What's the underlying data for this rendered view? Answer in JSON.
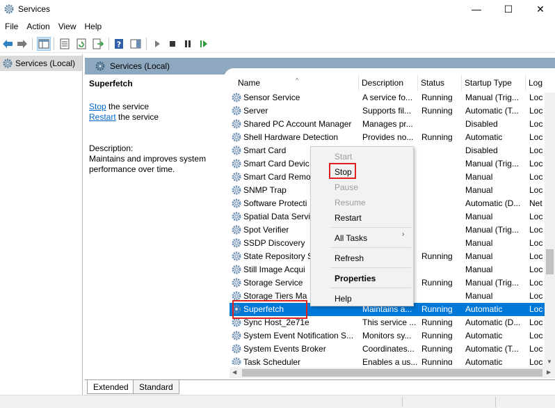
{
  "window": {
    "title": "Services",
    "controls": {
      "minimize": "—",
      "maximize": "☐",
      "close": "✕"
    }
  },
  "menu": [
    "File",
    "Action",
    "View",
    "Help"
  ],
  "toolbar": {
    "icons": [
      "back-arrow-icon",
      "forward-arrow-icon",
      "show-tree-icon",
      "properties-sheet-icon",
      "refresh-icon",
      "export-list-icon",
      "help-icon",
      "show-hide-pane-icon",
      "start-service-icon",
      "stop-service-icon",
      "pause-service-icon",
      "restart-service-icon"
    ]
  },
  "tree": {
    "root_label": "Services (Local)"
  },
  "main": {
    "header_title": "Services (Local)",
    "selected_service": "Superfetch",
    "stop_link": "Stop",
    "stop_suffix": " the service",
    "restart_link": "Restart",
    "restart_suffix": " the service",
    "description_label": "Description:",
    "description_text": "Maintains and improves system performance over time."
  },
  "columns": {
    "name": "Name",
    "description": "Description",
    "status": "Status",
    "startup": "Startup Type",
    "log": "Log"
  },
  "rows": [
    {
      "name": "Sensor Service",
      "description": "A service fo...",
      "status": "Running",
      "startup": "Manual (Trig...",
      "log": "Loc"
    },
    {
      "name": "Server",
      "description": "Supports fil...",
      "status": "Running",
      "startup": "Automatic (T...",
      "log": "Loc"
    },
    {
      "name": "Shared PC Account Manager",
      "description": "Manages pr...",
      "status": "",
      "startup": "Disabled",
      "log": "Loc"
    },
    {
      "name": "Shell Hardware Detection",
      "description": "Provides no...",
      "status": "Running",
      "startup": "Automatic",
      "log": "Loc"
    },
    {
      "name": "Smart Card",
      "description": "",
      "status": "",
      "startup": "Disabled",
      "log": "Loc"
    },
    {
      "name": "Smart Card Devic",
      "description": "",
      "status": "",
      "startup": "Manual (Trig...",
      "log": "Loc"
    },
    {
      "name": "Smart Card Remo",
      "description": "",
      "status": "",
      "startup": "Manual",
      "log": "Loc"
    },
    {
      "name": "SNMP Trap",
      "description": "",
      "status": "",
      "startup": "Manual",
      "log": "Loc"
    },
    {
      "name": "Software Protecti",
      "description": "",
      "status": "",
      "startup": "Automatic (D...",
      "log": "Net"
    },
    {
      "name": "Spatial Data Servi",
      "description": "",
      "status": "",
      "startup": "Manual",
      "log": "Loc"
    },
    {
      "name": "Spot Verifier",
      "description": "",
      "status": "",
      "startup": "Manual (Trig...",
      "log": "Loc"
    },
    {
      "name": "SSDP Discovery",
      "description": "",
      "status": "",
      "startup": "Manual",
      "log": "Loc"
    },
    {
      "name": "State Repository S",
      "description": "",
      "status": "Running",
      "startup": "Manual",
      "log": "Loc"
    },
    {
      "name": "Still Image Acqui",
      "description": "",
      "status": "",
      "startup": "Manual",
      "log": "Loc"
    },
    {
      "name": "Storage Service",
      "description": "",
      "status": "Running",
      "startup": "Manual (Trig...",
      "log": "Loc"
    },
    {
      "name": "Storage Tiers Ma",
      "description": "",
      "status": "",
      "startup": "Manual",
      "log": "Loc"
    },
    {
      "name": "Superfetch",
      "description": "Maintains a...",
      "status": "Running",
      "startup": "Automatic",
      "log": "Loc",
      "selected": true
    },
    {
      "name": "Sync Host_2e71e",
      "description": "This service ...",
      "status": "Running",
      "startup": "Automatic (D...",
      "log": "Loc"
    },
    {
      "name": "System Event Notification S...",
      "description": "Monitors sy...",
      "status": "Running",
      "startup": "Automatic",
      "log": "Loc"
    },
    {
      "name": "System Events Broker",
      "description": "Coordinates...",
      "status": "Running",
      "startup": "Automatic (T...",
      "log": "Loc"
    },
    {
      "name": "Task Scheduler",
      "description": "Enables a us...",
      "status": "Running",
      "startup": "Automatic",
      "log": "Loc"
    }
  ],
  "context_menu": {
    "start": "Start",
    "stop": "Stop",
    "pause": "Pause",
    "resume": "Resume",
    "restart": "Restart",
    "all_tasks": "All Tasks",
    "all_tasks_arrow": "›",
    "refresh": "Refresh",
    "properties": "Properties",
    "help": "Help"
  },
  "tabs": [
    "Extended",
    "Standard"
  ],
  "colors": {
    "selection": "#0078d7",
    "header_band": "#8da8bf",
    "highlight_box": "#e02020",
    "link": "#0066cc"
  }
}
